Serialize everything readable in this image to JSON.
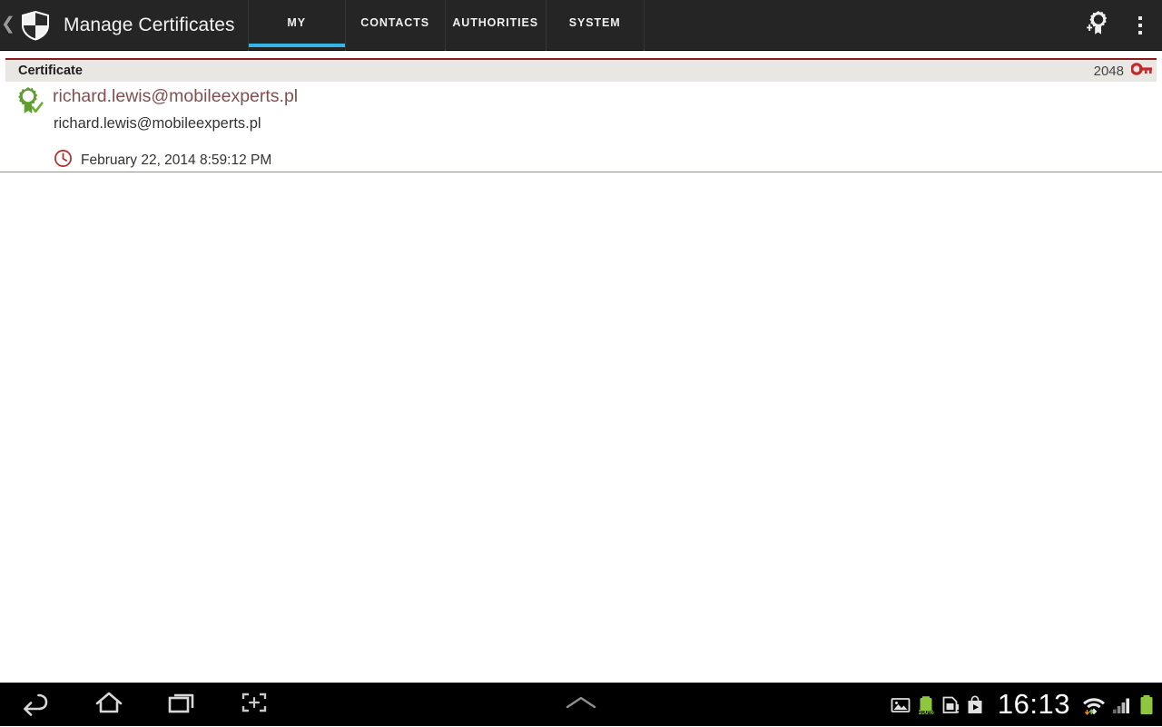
{
  "action_bar": {
    "up_icon": "chevron-left-icon",
    "app_icon": "shield-icon",
    "title": "Manage Certificates",
    "tabs": [
      {
        "label": "MY",
        "active": true
      },
      {
        "label": "CONTACTS",
        "active": false
      },
      {
        "label": "AUTHORITIES",
        "active": false
      },
      {
        "label": "SYSTEM",
        "active": false
      }
    ],
    "actions": [
      {
        "name": "add-certificate-icon",
        "label": "Add certificate"
      },
      {
        "name": "overflow-menu-icon",
        "label": "More options"
      }
    ],
    "accent_color": "#33b5e5",
    "background_color": "#252525"
  },
  "list_header": {
    "title": "Certificate",
    "key_size": "2048",
    "key_icon": "key-icon",
    "key_icon_color": "#c62828",
    "top_rule_color": "#8c1c1c",
    "background_color": "#e9e7e3"
  },
  "certificates": [
    {
      "badge_icon": "certificate-verified-icon",
      "badge_color": "#5e9e2e",
      "title": "richard.lewis@mobileexperts.pl",
      "title_color": "#80504e",
      "subtitle": "richard.lewis@mobileexperts.pl",
      "date_icon": "clock-icon",
      "date_icon_color": "#b02a2a",
      "date": "February 22, 2014 8:59:12 PM"
    }
  ],
  "nav_bar": {
    "buttons": [
      {
        "name": "back-button",
        "label": "Back"
      },
      {
        "name": "home-button",
        "label": "Home"
      },
      {
        "name": "recents-button",
        "label": "Recent apps"
      },
      {
        "name": "screenshot-button",
        "label": "Screenshot"
      }
    ],
    "drawer_handle": "chevron-up-icon",
    "status": {
      "icons": [
        "screenshot-notification-icon",
        "battery-full-notification-icon",
        "sim-card-alert-icon",
        "play-store-icon"
      ],
      "battery_percent": "100%",
      "time": "16:13",
      "wifi_icon": "wifi-icon",
      "signal_icon": "cellular-signal-icon",
      "battery_icon": "battery-icon",
      "battery_color": "#8ec63f"
    }
  }
}
